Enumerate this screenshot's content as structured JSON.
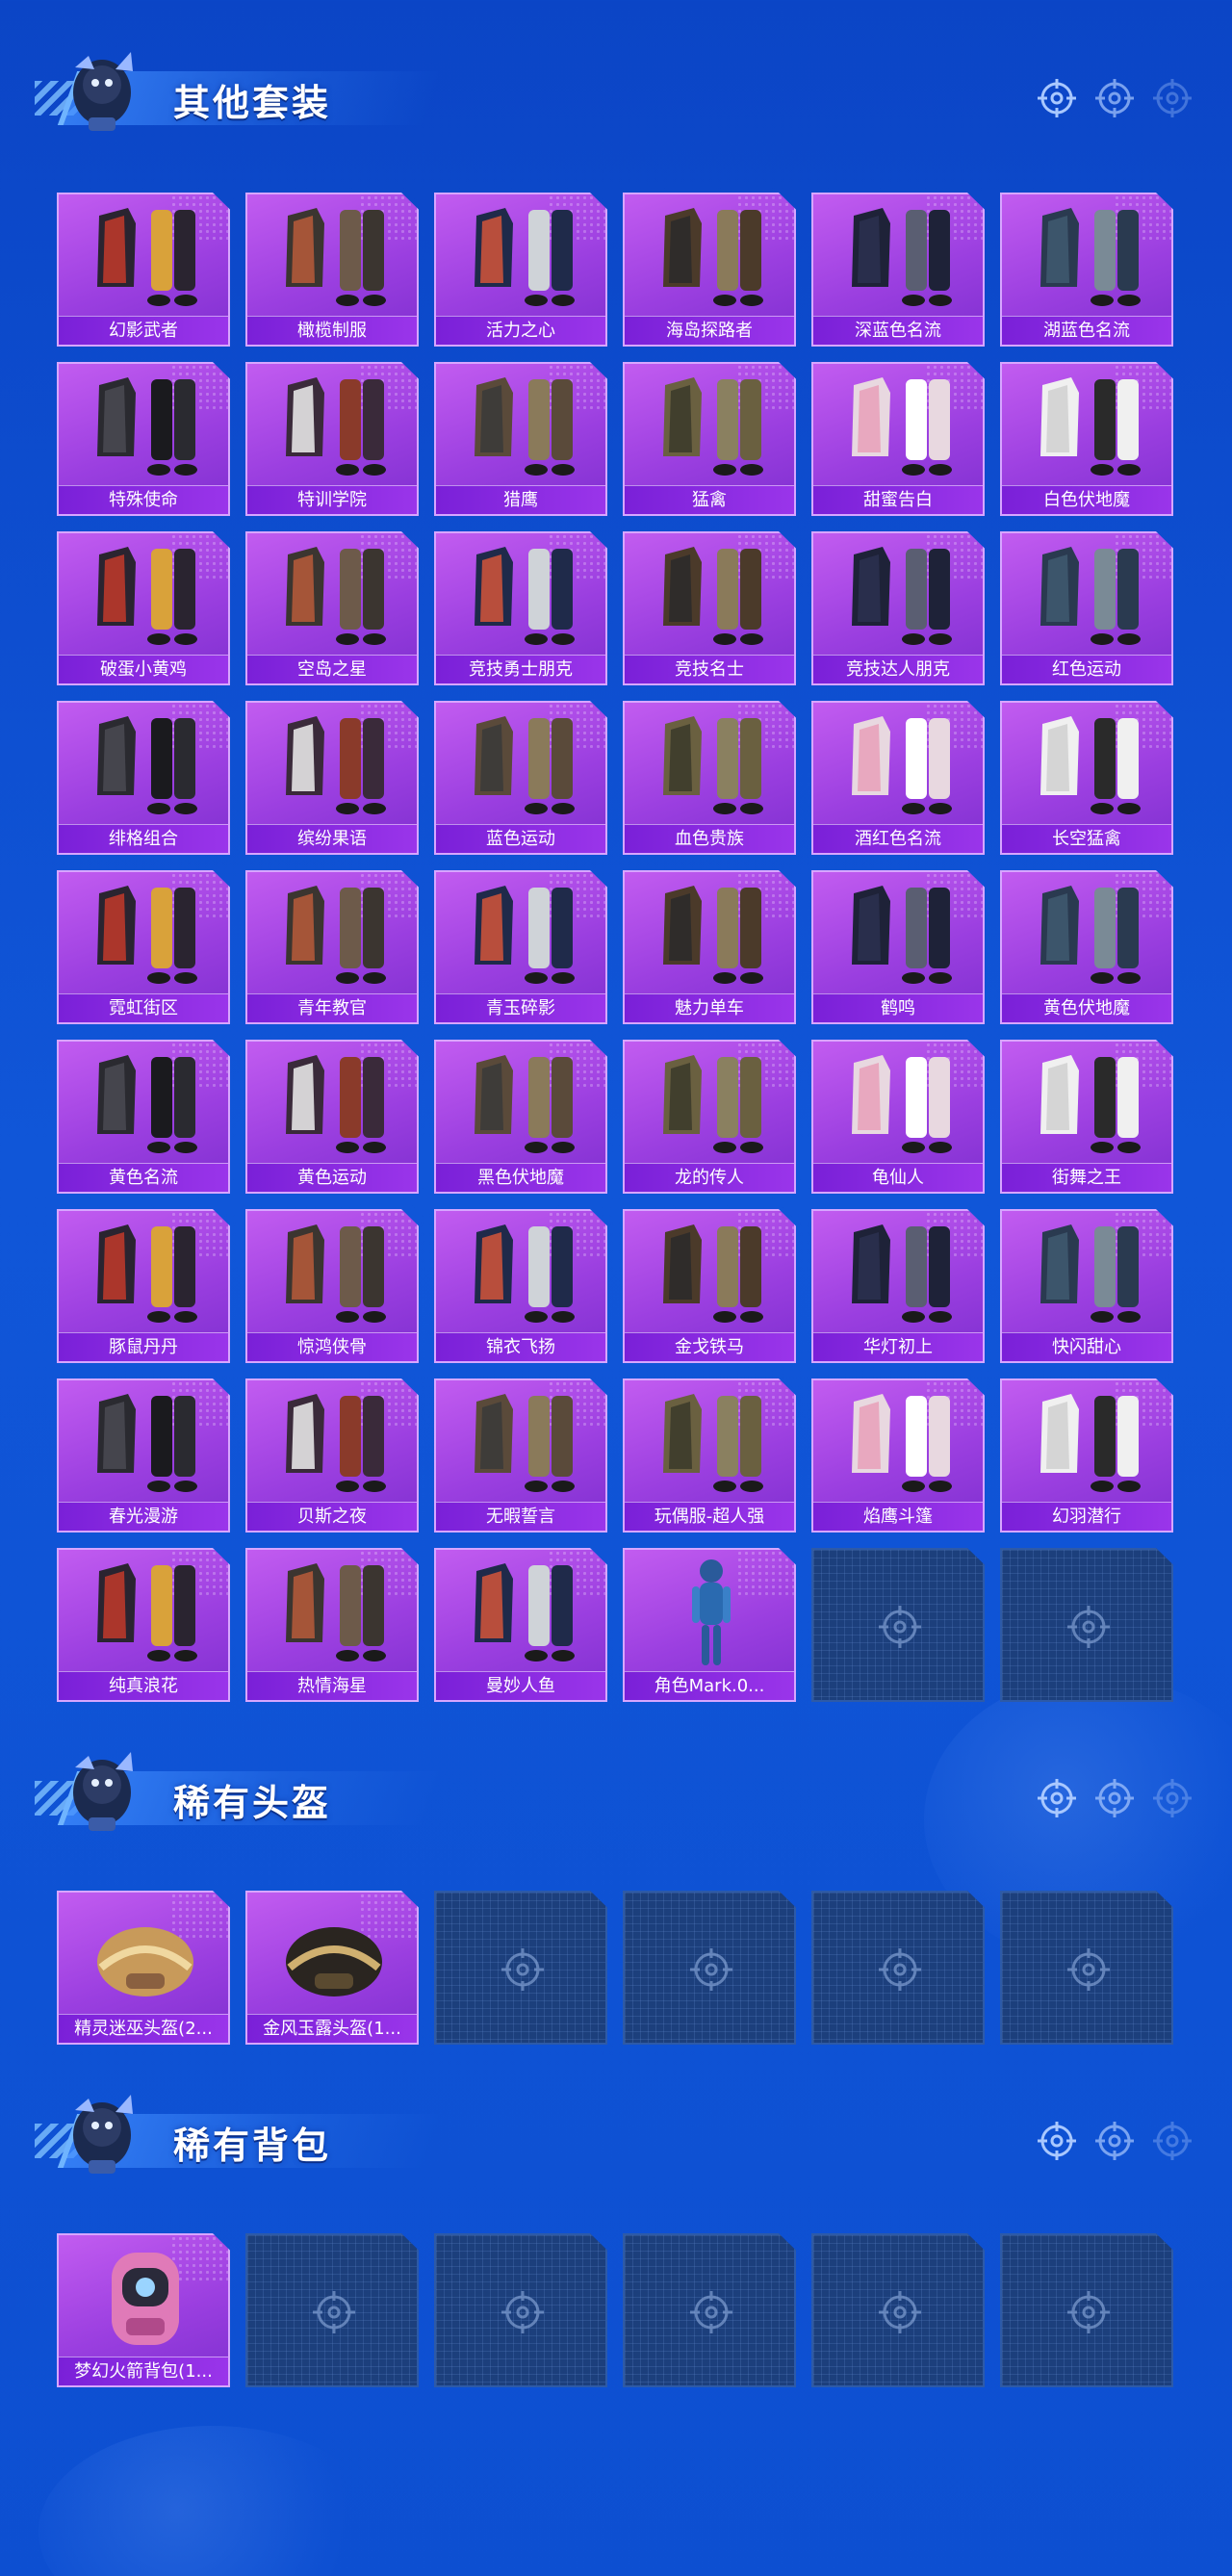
{
  "colors": {
    "background": "#0d4fd1",
    "card_purple": "#9b3fe0",
    "card_label": "#7a20d8",
    "empty_slot": "#1c3f7c"
  },
  "sections": [
    {
      "title": "其他套装",
      "items": [
        {
          "label": "幻影武者",
          "icon": "outfit-icon"
        },
        {
          "label": "橄榄制服",
          "icon": "outfit-icon"
        },
        {
          "label": "活力之心",
          "icon": "outfit-icon"
        },
        {
          "label": "海岛探路者",
          "icon": "outfit-icon"
        },
        {
          "label": "深蓝色名流",
          "icon": "outfit-icon"
        },
        {
          "label": "湖蓝色名流",
          "icon": "outfit-icon"
        },
        {
          "label": "特殊使命",
          "icon": "outfit-icon"
        },
        {
          "label": "特训学院",
          "icon": "outfit-icon"
        },
        {
          "label": "猎鹰",
          "icon": "outfit-icon"
        },
        {
          "label": "猛禽",
          "icon": "outfit-icon"
        },
        {
          "label": "甜蜜告白",
          "icon": "outfit-icon"
        },
        {
          "label": "白色伏地魔",
          "icon": "outfit-icon"
        },
        {
          "label": "破蛋小黄鸡",
          "icon": "outfit-icon"
        },
        {
          "label": "空岛之星",
          "icon": "outfit-icon"
        },
        {
          "label": "竞技勇士朋克",
          "icon": "outfit-icon"
        },
        {
          "label": "竞技名士",
          "icon": "outfit-icon"
        },
        {
          "label": "竞技达人朋克",
          "icon": "outfit-icon"
        },
        {
          "label": "红色运动",
          "icon": "outfit-icon"
        },
        {
          "label": "绯格组合",
          "icon": "outfit-icon"
        },
        {
          "label": "缤纷果语",
          "icon": "outfit-icon"
        },
        {
          "label": "蓝色运动",
          "icon": "outfit-icon"
        },
        {
          "label": "血色贵族",
          "icon": "outfit-icon"
        },
        {
          "label": "酒红色名流",
          "icon": "outfit-icon"
        },
        {
          "label": "长空猛禽",
          "icon": "outfit-icon"
        },
        {
          "label": "霓虹街区",
          "icon": "outfit-icon"
        },
        {
          "label": "青年教官",
          "icon": "outfit-icon"
        },
        {
          "label": "青玉碎影",
          "icon": "outfit-icon"
        },
        {
          "label": "魅力单车",
          "icon": "outfit-icon"
        },
        {
          "label": "鹤鸣",
          "icon": "outfit-icon"
        },
        {
          "label": "黄色伏地魔",
          "icon": "outfit-icon"
        },
        {
          "label": "黄色名流",
          "icon": "outfit-icon"
        },
        {
          "label": "黄色运动",
          "icon": "outfit-icon"
        },
        {
          "label": "黑色伏地魔",
          "icon": "outfit-icon"
        },
        {
          "label": "龙的传人",
          "icon": "outfit-icon"
        },
        {
          "label": "龟仙人",
          "icon": "outfit-icon"
        },
        {
          "label": "街舞之王",
          "icon": "outfit-icon"
        },
        {
          "label": "豚鼠丹丹",
          "icon": "outfit-icon"
        },
        {
          "label": "惊鸿侠骨",
          "icon": "outfit-icon"
        },
        {
          "label": "锦衣飞扬",
          "icon": "outfit-icon"
        },
        {
          "label": "金戈铁马",
          "icon": "outfit-icon"
        },
        {
          "label": "华灯初上",
          "icon": "outfit-icon"
        },
        {
          "label": "快闪甜心",
          "icon": "outfit-icon"
        },
        {
          "label": "春光漫游",
          "icon": "outfit-icon"
        },
        {
          "label": "贝斯之夜",
          "icon": "outfit-icon"
        },
        {
          "label": "无暇誓言",
          "icon": "outfit-icon"
        },
        {
          "label": "玩偶服-超人强",
          "icon": "outfit-icon"
        },
        {
          "label": "焰鹰斗篷",
          "icon": "outfit-icon"
        },
        {
          "label": "幻羽潜行",
          "icon": "outfit-icon"
        },
        {
          "label": "纯真浪花",
          "icon": "outfit-icon"
        },
        {
          "label": "热情海星",
          "icon": "outfit-icon"
        },
        {
          "label": "曼妙人鱼",
          "icon": "outfit-icon"
        },
        {
          "label": "角色Mark.0...",
          "icon": "character-icon"
        },
        {
          "label": "",
          "icon": "empty-slot-icon"
        },
        {
          "label": "",
          "icon": "empty-slot-icon"
        }
      ]
    },
    {
      "title": "稀有头盔",
      "items": [
        {
          "label": "精灵迷巫头盔(2...",
          "icon": "helmet-icon"
        },
        {
          "label": "金风玉露头盔(1...",
          "icon": "helmet-icon"
        },
        {
          "label": "",
          "icon": "empty-slot-icon"
        },
        {
          "label": "",
          "icon": "empty-slot-icon"
        },
        {
          "label": "",
          "icon": "empty-slot-icon"
        },
        {
          "label": "",
          "icon": "empty-slot-icon"
        }
      ]
    },
    {
      "title": "稀有背包",
      "items": [
        {
          "label": "梦幻火箭背包(1...",
          "icon": "backpack-icon"
        },
        {
          "label": "",
          "icon": "empty-slot-icon"
        },
        {
          "label": "",
          "icon": "empty-slot-icon"
        },
        {
          "label": "",
          "icon": "empty-slot-icon"
        },
        {
          "label": "",
          "icon": "empty-slot-icon"
        },
        {
          "label": "",
          "icon": "empty-slot-icon"
        }
      ]
    }
  ]
}
